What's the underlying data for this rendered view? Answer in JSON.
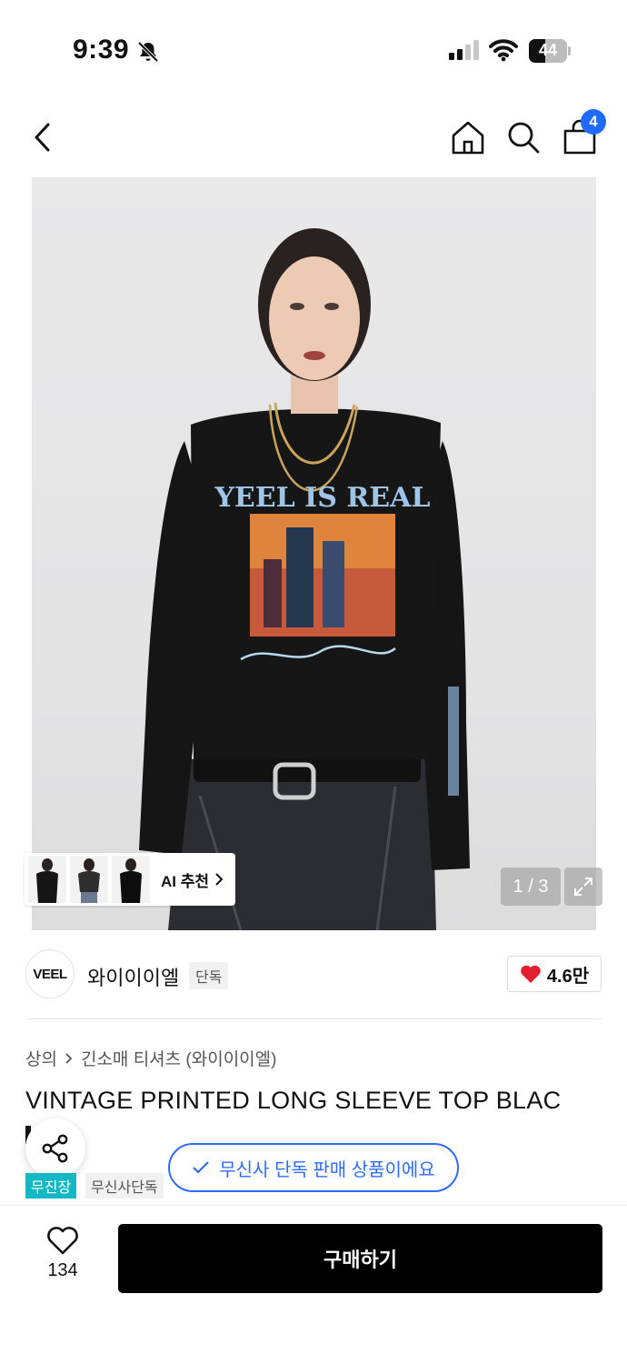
{
  "status_bar": {
    "time": "9:39",
    "battery": "44",
    "battery_level": 0.44,
    "icons": [
      "bell-slash-icon",
      "cellular-signal-icon",
      "wifi-icon",
      "battery-icon"
    ]
  },
  "nav": {
    "icons": [
      "chevron-left-icon",
      "home-icon",
      "search-icon",
      "shopping-bag-icon"
    ],
    "cart_count": "4"
  },
  "hero": {
    "ai_recommend_label": "AI 추천",
    "page_counter": "1 / 3",
    "print_text": "YEEL IS REAL"
  },
  "brand": {
    "logo_text": "VEEL",
    "name": "와이이이엘",
    "badge": "단독",
    "likes": "4.6만"
  },
  "breadcrumb": {
    "category": "상의",
    "subcategory": "긴소매 티셔츠 (와이이이엘)"
  },
  "product": {
    "title": "VINTAGE PRINTED LONG SLEEVE TOP BLAC",
    "tags": [
      "무진장",
      "무신사단독"
    ],
    "exclusive_notice": "무신사 단독 판매 상품이에요"
  },
  "bottom": {
    "wish_count": "134",
    "buy_label": "구매하기"
  },
  "colors": {
    "accent_blue": "#2f6bff",
    "badge_blue": "#1f6bff",
    "tag_teal": "#14b8c4",
    "heart_red": "#e5202e",
    "buy_black": "#000000"
  }
}
